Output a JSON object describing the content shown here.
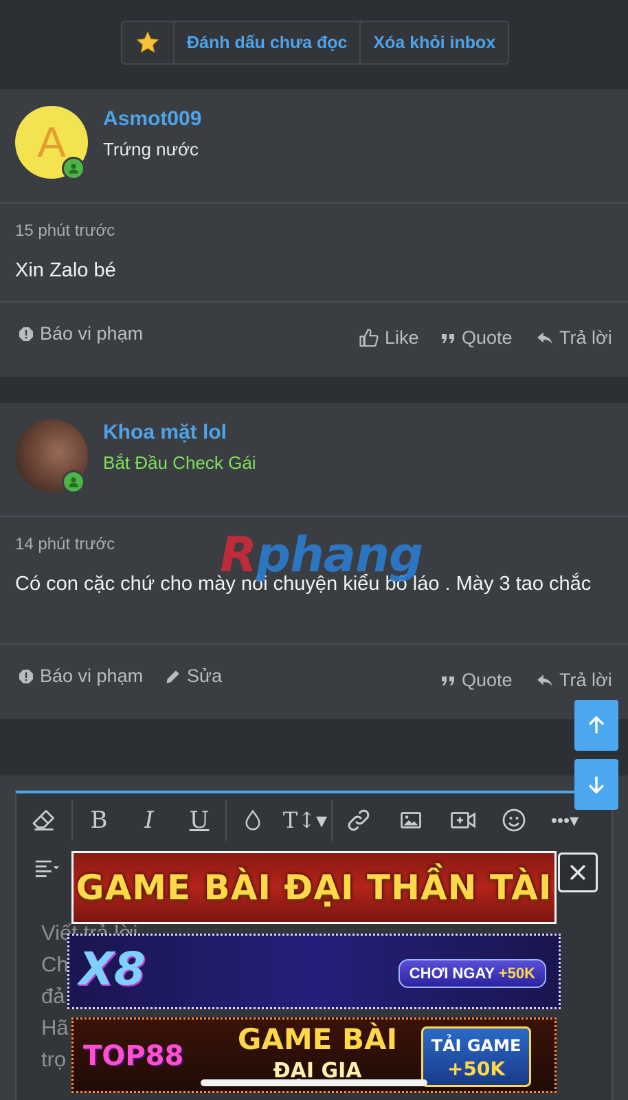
{
  "toolbar": {
    "mark_unread": "Đánh dấu chưa đọc",
    "remove_inbox": "Xóa khỏi inbox"
  },
  "messages": [
    {
      "avatar_letter": "A",
      "username": "Asmot009",
      "user_title": "Trứng nước",
      "time": "15 phút trước",
      "text": "Xin Zalo bé",
      "actions": {
        "report": "Báo vi phạm",
        "like": "Like",
        "quote": "Quote",
        "reply": "Trả lời"
      }
    },
    {
      "username": "Khoa mặt lol",
      "user_title": "Bắt Đầu Check Gái",
      "time": "14 phút trước",
      "text": "Có con cặc chứ cho mày nói chuyện kiểu bố láo . Mày 3 tao chắc",
      "actions": {
        "report": "Báo vi phạm",
        "edit": "Sửa",
        "quote": "Quote",
        "reply": "Trả lời"
      }
    }
  ],
  "watermark": {
    "part1": "R",
    "part2": "phang"
  },
  "editor": {
    "placeholder_lines": [
      "Viết trả lời...",
      "Ch",
      "đả",
      "Hã",
      "trọ"
    ]
  },
  "ads": {
    "ad1": "GAME BÀI ĐẠI THẦN TÀI",
    "ad2_logo": "X8",
    "ad2_cta_a": "CHƠI NGAY",
    "ad2_cta_b": "+50K",
    "ad3_logo": "TOP88",
    "ad3_line1": "GAME BÀI",
    "ad3_line2": "ĐẠI GIA",
    "ad3_cta_a": "TẢI GAME",
    "ad3_cta_b": "+50K"
  },
  "colors": {
    "accent": "#4fa3e8",
    "background": "#2c2f34",
    "card": "#3a3d42",
    "online": "#4bb548",
    "title_green": "#7ee05a"
  }
}
